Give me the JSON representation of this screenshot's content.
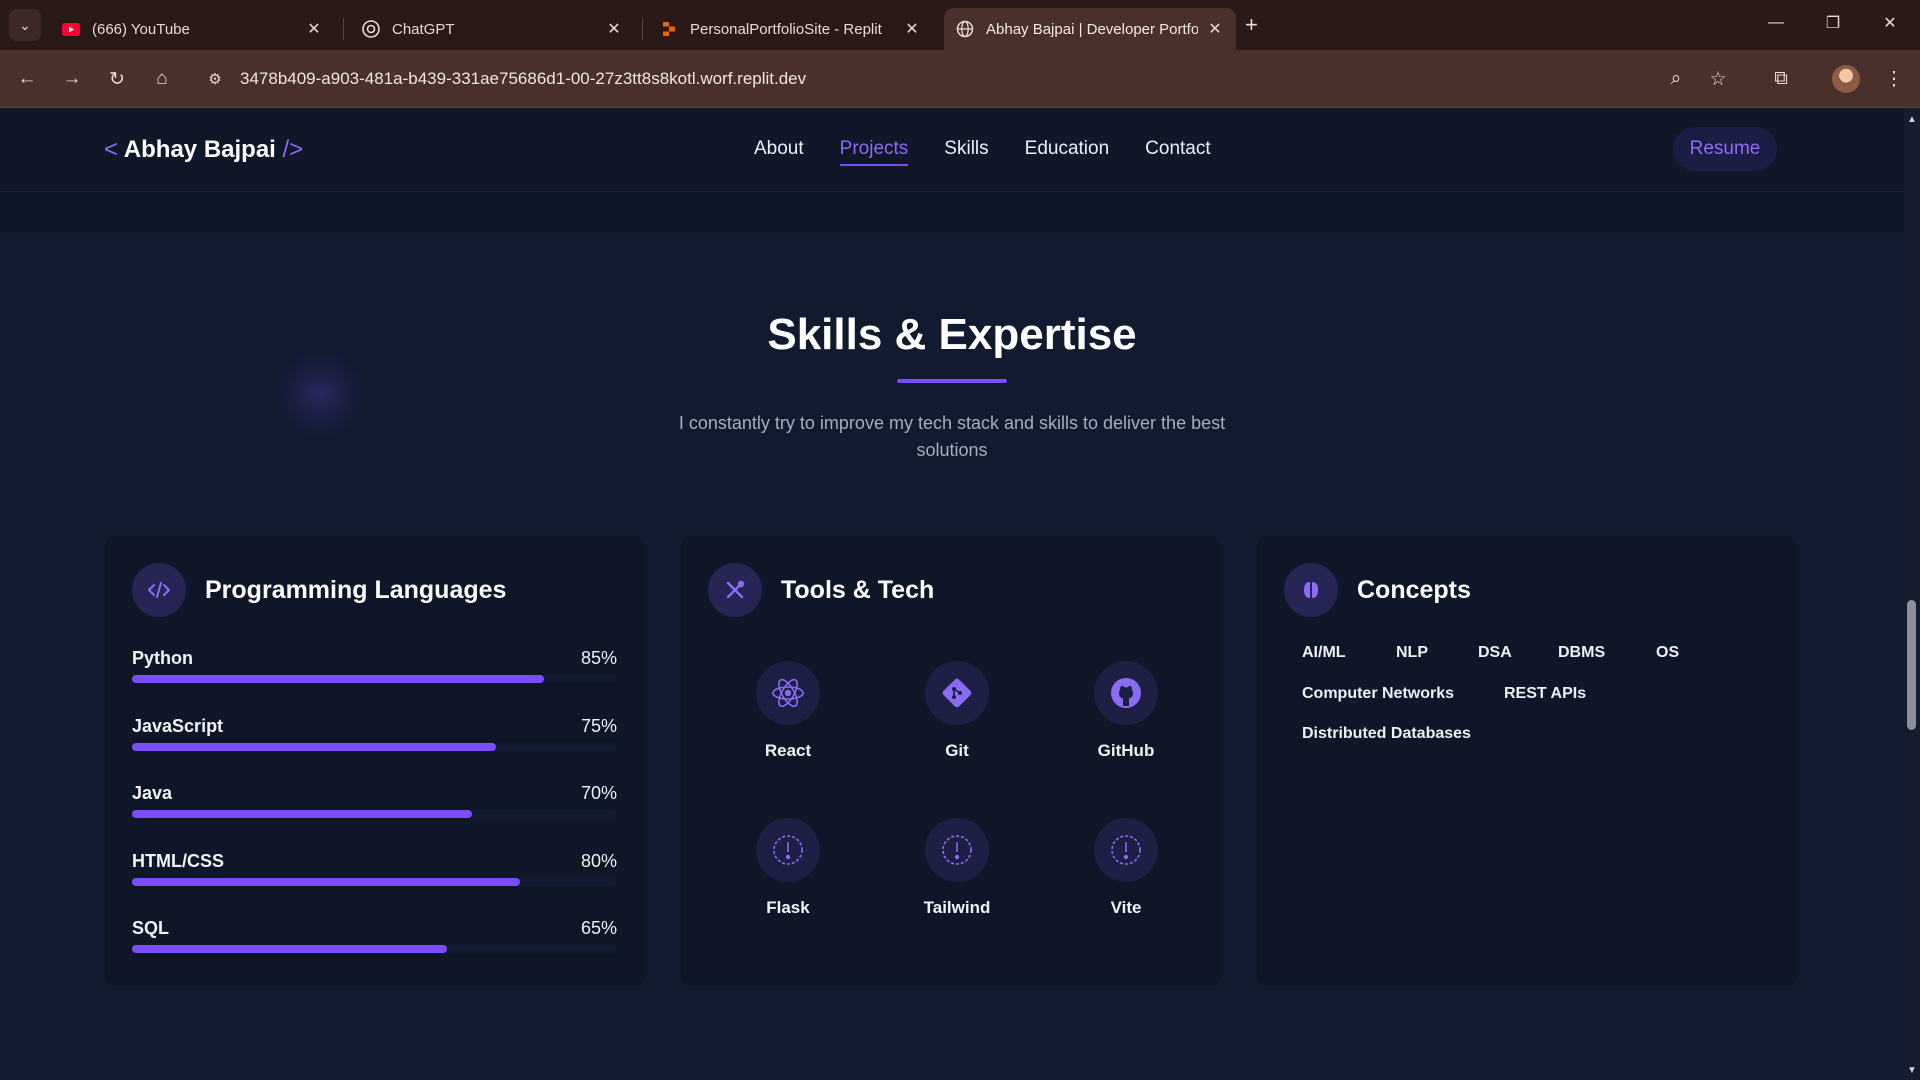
{
  "browser": {
    "tabs": [
      {
        "title": "(666) YouTube",
        "icon": "youtube-icon"
      },
      {
        "title": "ChatGPT",
        "icon": "chatgpt-icon"
      },
      {
        "title": "PersonalPortfolioSite - Replit",
        "icon": "replit-icon"
      },
      {
        "title": "Abhay Bajpai | Developer Portfo",
        "icon": "globe-icon"
      }
    ],
    "url": "3478b409-a903-481a-b439-331ae75686d1-00-27z3tt8s8kotl.worf.replit.dev"
  },
  "nav": {
    "brand_open": "<",
    "brand_name": "Abhay Bajpai",
    "brand_close": "/>",
    "links": [
      "About",
      "Projects",
      "Skills",
      "Education",
      "Contact"
    ],
    "active_link": "Projects",
    "resume_label": "Resume"
  },
  "skills_section": {
    "title": "Skills & Expertise",
    "subtitle": "I constantly try to improve my tech stack and skills to deliver the best solutions"
  },
  "cards": {
    "languages": {
      "title": "Programming Languages",
      "icon": "code-icon",
      "items": [
        {
          "name": "Python",
          "percent_label": "85%",
          "percent": 85
        },
        {
          "name": "JavaScript",
          "percent_label": "75%",
          "percent": 75
        },
        {
          "name": "Java",
          "percent_label": "70%",
          "percent": 70
        },
        {
          "name": "HTML/CSS",
          "percent_label": "80%",
          "percent": 80
        },
        {
          "name": "SQL",
          "percent_label": "65%",
          "percent": 65
        }
      ]
    },
    "tools": {
      "title": "Tools & Tech",
      "icon": "tools-icon",
      "items": [
        {
          "name": "React",
          "icon": "react-icon"
        },
        {
          "name": "Git",
          "icon": "git-icon"
        },
        {
          "name": "GitHub",
          "icon": "github-icon"
        },
        {
          "name": "Flask",
          "icon": "alert-icon"
        },
        {
          "name": "Tailwind",
          "icon": "alert-icon"
        },
        {
          "name": "Vite",
          "icon": "alert-icon"
        }
      ]
    },
    "concepts": {
      "title": "Concepts",
      "icon": "brain-icon",
      "items": [
        "AI/ML",
        "NLP",
        "DSA",
        "DBMS",
        "OS",
        "Computer Networks",
        "REST APIs",
        "Distributed Databases"
      ]
    }
  },
  "colors": {
    "accent": "#7c4dff",
    "page_bg": "#111a2e",
    "card_bg": "#0f1627"
  }
}
